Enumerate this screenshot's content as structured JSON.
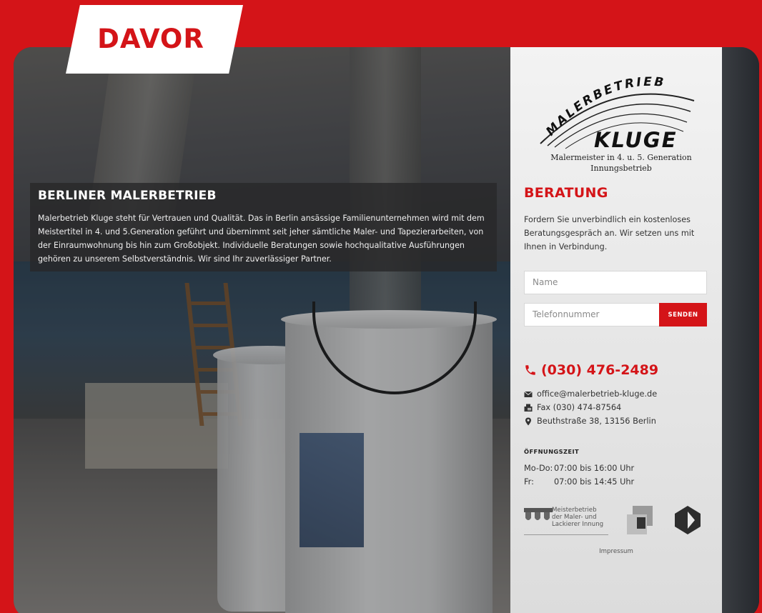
{
  "brand": {
    "tag": "DAVOR",
    "accent": "#d41418"
  },
  "intro": {
    "title": "BERLINER MALERBETRIEB",
    "text": "Malerbetrieb Kluge steht für Vertrauen und Qualität. Das in Berlin ansässige Familienunternehmen wird mit dem Meistertitel in 4. und 5.Generation geführt und übernimmt seit jeher sämtliche Maler- und Tapezierarbeiten, von der Einraumwohnung bis hin zum Großobjekt. Individuelle Beratungen sowie hochqualitative Ausführungen gehören zu unserem Selbstverständnis. Wir sind Ihr zuverlässiger Partner."
  },
  "logo": {
    "arc_text": "MALERBETRIEB",
    "name": "KLUGE",
    "line1": "Malermeister in 4. u. 5. Generation",
    "line2": "Innungsbetrieb"
  },
  "beratung": {
    "title": "BERATUNG",
    "text": "Fordern Sie unverbindlich ein kostenloses Beratungsgespräch an. Wir setzen uns mit Ihnen in Verbindung."
  },
  "form": {
    "name_placeholder": "Name",
    "tel_placeholder": "Telefonnummer",
    "send_label": "SENDEN"
  },
  "contact": {
    "phone": "(030) 476-2489",
    "email": "office@malerbetrieb-kluge.de",
    "fax": "Fax (030) 474-87564",
    "address": "Beuthstraße 38, 13156 Berlin"
  },
  "hours": {
    "title": "ÖFFNUNGSZEIT",
    "rows": [
      {
        "day": "Mo-Do:",
        "time": "07:00 bis 16:00 Uhr"
      },
      {
        "day": "Fr:",
        "time": "07:00 bis 14:45 Uhr"
      }
    ]
  },
  "badges": {
    "innung_line1": "Meisterbetrieb",
    "innung_line2": "der Maler- und",
    "innung_line3": "Lackierer Innung"
  },
  "footer": {
    "impressum": "Impressum"
  },
  "icons": {
    "phone": "phone-icon",
    "email": "envelope-icon",
    "fax": "fax-icon",
    "address": "map-marker-icon"
  }
}
